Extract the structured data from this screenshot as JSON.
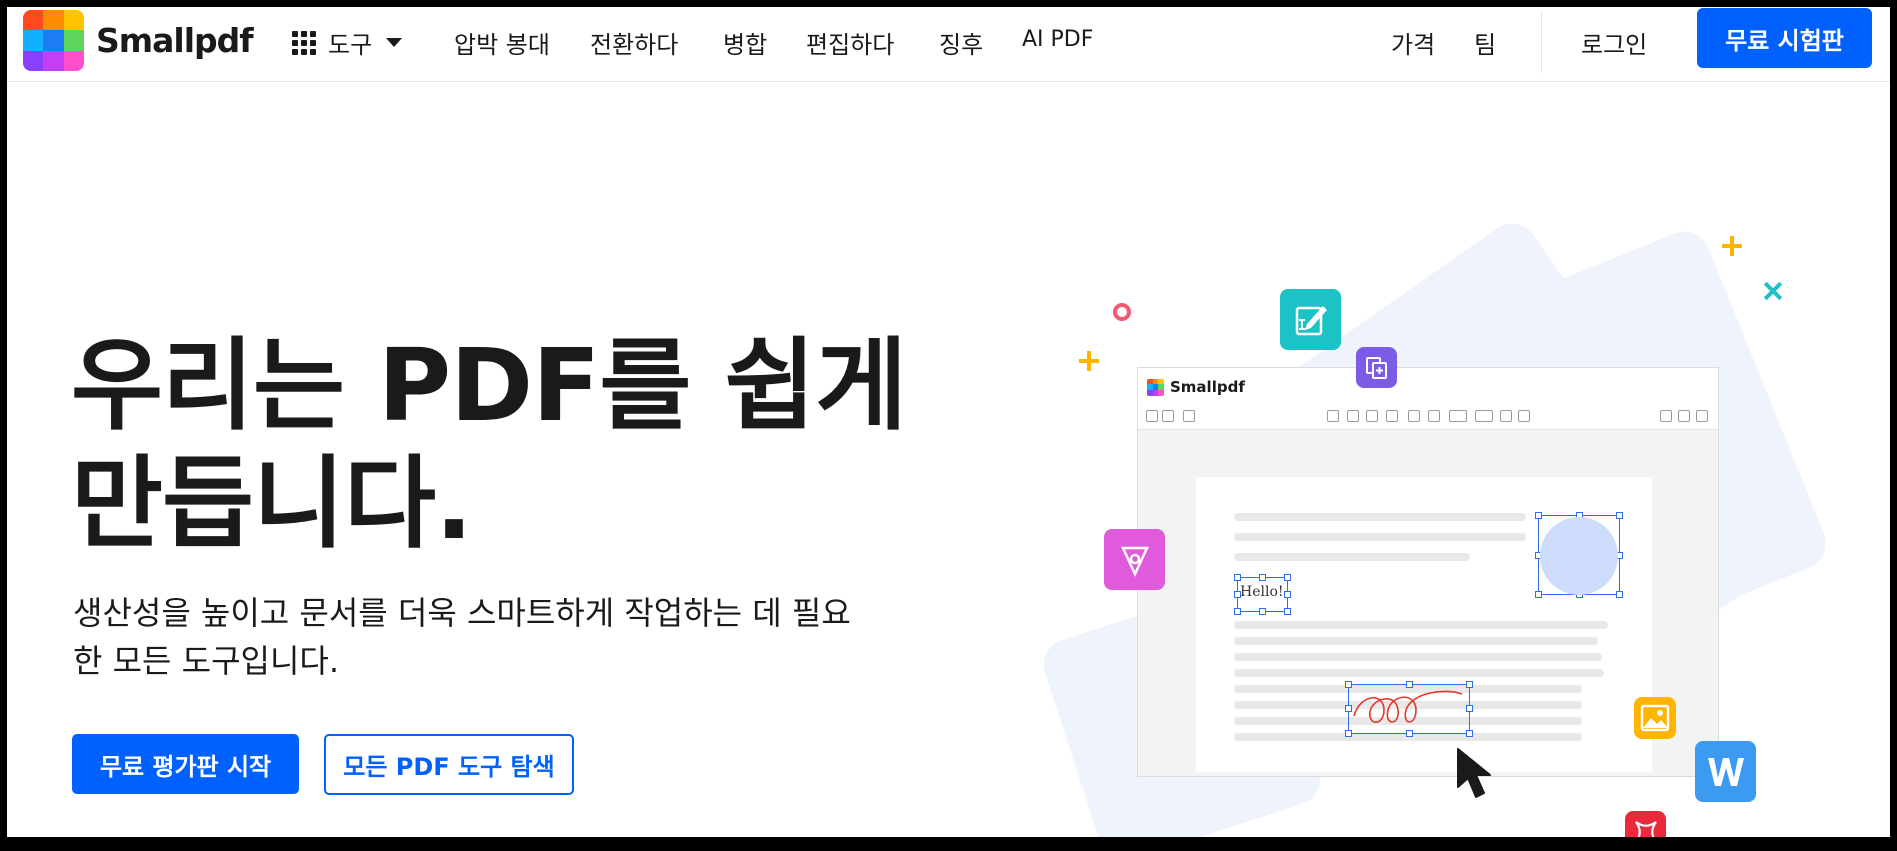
{
  "brand": {
    "name": "Smallpdf",
    "logo_colors": [
      "#ff4a1c",
      "#ff8c00",
      "#ffc300",
      "#12b0ff",
      "#1d7cf2",
      "#5ed65b",
      "#8a3ffc",
      "#c33ff5",
      "#ff4fcf"
    ]
  },
  "nav": {
    "tools_label": "도구",
    "links": [
      "압박 봉대",
      "전환하다",
      "병합",
      "편집하다",
      "징후",
      "AI PDF"
    ],
    "pricing": "가격",
    "team": "팀",
    "login": "로그인",
    "cta": "무료 시험판"
  },
  "hero": {
    "headline_line1": "우리는 PDF를 쉽게",
    "headline_line2": "만듭니다.",
    "subtitle": "생산성을 높이고 문서를 더욱 스마트하게 작업하는 데 필요한 모든 도구입니다.",
    "primary_cta": "무료 평가판 시작",
    "secondary_cta": "모든 PDF 도구 탐색"
  },
  "illustration": {
    "app_name": "Smallpdf",
    "sample_text": "Hello!",
    "icons": [
      "edit-icon",
      "add-page-icon",
      "pen-sign-icon",
      "image-icon",
      "word-icon",
      "compress-icon",
      "cursor-icon"
    ]
  },
  "colors": {
    "accent": "#0061fe",
    "text": "#1a1a1a",
    "teal": "#1dc2c6",
    "purple": "#7c5ce6",
    "pink": "#e05adc",
    "yellow": "#ffb400",
    "word_blue": "#3c9bf0",
    "red": "#e82a3a"
  }
}
